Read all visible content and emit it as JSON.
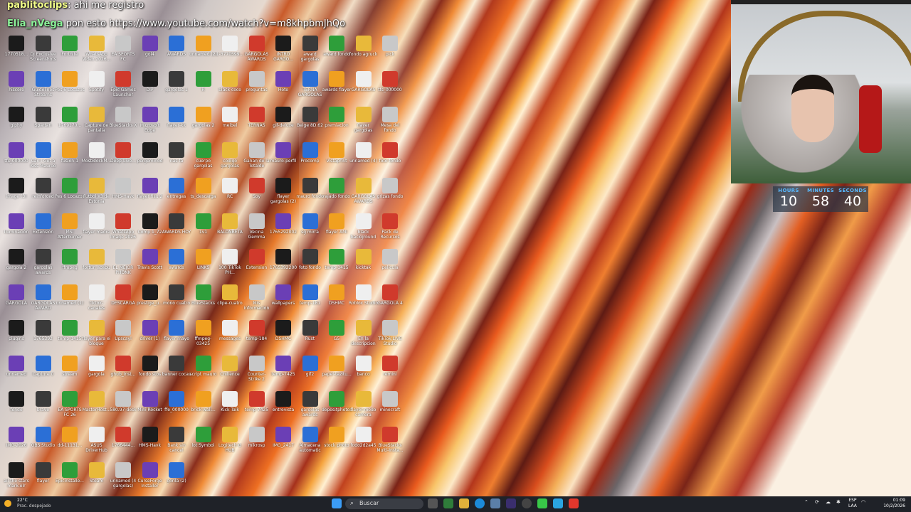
{
  "chat": [
    {
      "user": "pablitoclips",
      "text": ": ahi me registro"
    },
    {
      "user": "Elia_nVega",
      "text": " pon esto https://www.youtube.com/watch?v=m8khpbmJhQo"
    }
  ],
  "desktop_icons": [
    "1770518...",
    "DJ Exclusive Screenshots",
    "Fortnite",
    "WhatsApp Video 2026...",
    "EA SPORTS FC",
    "gol4",
    "AWARDS",
    "unnamed (2)",
    "1-3770599...",
    "GARGOLAS AWARDS",
    "INTRO GARGO...",
    "award gargolas",
    "award fondo",
    "fondo agruck",
    "pick",
    "hiscore",
    "Guidelines Streams",
    "Pes 6 Locazos",
    "Spotify",
    "Epic Games Launcher",
    "DIP",
    "gargolas 1",
    "R",
    "black coco",
    "preguntas",
    "Hoto",
    "TERNA GARGOLAS",
    "awards flayer",
    "GARGOLAS",
    "tfs_000000",
    "giphy",
    "Spartan",
    "1769170...",
    "Capture de pantalla",
    "BlueStacks X",
    "Microsoft Edge",
    "flayer-kk",
    "gargolas 2",
    "meibel",
    "TERNAS",
    "gif-deluxe",
    "Beige 8D.62",
    "premiacion",
    "flayer gargolas",
    "Mesa del fondo",
    "tfs_000000",
    "Can I Get a Kiss Mauroo",
    "fusion-1",
    "MostBlockM...",
    "Deep-Live...",
    "pergeminod",
    "nas fa",
    "cuerpo gargolas",
    "codigo gargolas",
    "Ganan de la Totalde",
    "mauro-perfil",
    "Procomp",
    "Vistaprint",
    "unnamed (4)",
    "foto fondo",
    "image (3)",
    "reinforced",
    "Pes 6 Locazos",
    "Futbol x3 de Estonia",
    "HMS-Havk",
    "flayer fisu 2",
    "entregas",
    "ts_descarga",
    "RC",
    "Soy",
    "flayer gargolas (2)",
    "mauro fondo",
    "rajado fondo",
    "GARGOLAS AWARDS",
    "grizas fondo",
    "Iluminacion",
    "Extension",
    "MSI Afterburner",
    "flayer madre",
    "WhatsApp Image 2026",
    "Comp 1_72",
    "AWARDS HOY",
    "1v1",
    "BALONBETA",
    "Vecina Gemma",
    "1765292002",
    "sg mirra",
    "flayer AMI",
    "black background",
    "Pack de Recursos",
    "gargola 2",
    "gargolas awards",
    "ffmpeg",
    "fortun acebu",
    "EL MEJOR PHONK",
    "Travis Scott",
    "awards",
    "LINKS",
    "100 TikTok PH...",
    "Extension",
    "1765392200",
    "foto fondo",
    "temp-1415",
    "kicktak",
    "pelicula",
    "GARGOLA",
    "GARGOLAS AWARD",
    "unnamed (1)",
    "tiktok-canales",
    "DESCARGA",
    "prestige_u...",
    "mono cuatro",
    "BlueStacks",
    "clipe-cuatro",
    "Mis informacion",
    "wallpapers",
    "temp-181",
    "DSHMC",
    "Roblox Studio",
    "GARGOLA 4",
    "plugins",
    "1765392",
    "temp-1415",
    "flayer para el bloque",
    "Upscayl",
    "driver (1)",
    "flayer mayo",
    "ffmpeg-03425",
    "messages",
    "temp-184",
    "DSHMC",
    "Rust",
    "G5",
    "En la descripcion",
    "TikTok LIVE Studio",
    "unnamed",
    "Capture 0",
    "stream",
    "gargola",
    "ghub_inst...",
    "fondo stos",
    "banner cocas",
    "script mauro",
    "Chilience",
    "Counter-Strike 2",
    "temp-7425",
    "gif2",
    "papel-tazitu...",
    "banco",
    "remini",
    "fondo",
    "brave",
    "EA SPORTS FC 26",
    "MasterHost...",
    "580.97-desk",
    "Mini Rocket",
    "ffe_000000",
    "brick-wall...",
    "Kick Talk",
    "temp-7425",
    "entrevista",
    "gargolas awards",
    "depositphotos",
    "flayer-modo camera",
    "minecraft",
    "IMG-2026",
    "OBS Studio",
    "dd-11131...",
    "ASUS DriverHub",
    "1766444...",
    "HMS-Havk",
    "Bank sin cancel",
    "lot Symbol",
    "Logitech G HUB",
    "mikrosp",
    "IMG_2417",
    "Almacena automatic",
    "stock photo",
    "fodo2d2a45",
    "BlueStacks Multi-Insta...",
    "all the stars mark.elr",
    "flayer",
    "Epicinstalle...",
    "Steam",
    "unnamed (4 gargolas)",
    "CurseForge Installer",
    "gorila (2)"
  ],
  "timer": {
    "hours_label": "HOURS",
    "hours": "10",
    "minutes_label": "MINUTES",
    "minutes": "58",
    "seconds_label": "SECONDS",
    "seconds": "40"
  },
  "taskbar": {
    "temperature": "22°C",
    "weather": "Prac. despejado",
    "search_placeholder": "Buscar",
    "lang_top": "ESP",
    "lang_bottom": "LAA",
    "time": "01:09",
    "date": "10/2/2026"
  },
  "colors": {
    "timer_label": "#58b9ff",
    "taskbar": "#1f2228"
  }
}
